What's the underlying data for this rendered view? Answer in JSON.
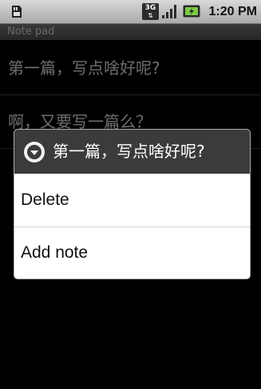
{
  "status_bar": {
    "time": "1:20 PM",
    "network_label": "3G",
    "network_arrows": "⇅",
    "left_icon": "sd-card-icon",
    "signal_icon": "signal-bars-icon",
    "battery_icon": "battery-charging-icon"
  },
  "app": {
    "title": "Note pad"
  },
  "notes": [
    {
      "title": "第一篇，写点啥好呢?"
    },
    {
      "title": "啊，又要写一篇么？"
    }
  ],
  "context_menu": {
    "title": "第一篇，写点啥好呢?",
    "header_icon": "chevron-down-circle-icon",
    "items": [
      {
        "label": "Delete"
      },
      {
        "label": "Add note"
      }
    ]
  },
  "colors": {
    "status_bar": "#bdbdbd",
    "dialog_header": "#3b3b3b",
    "dialog_body": "#ffffff",
    "battery_green": "#7ac943"
  }
}
